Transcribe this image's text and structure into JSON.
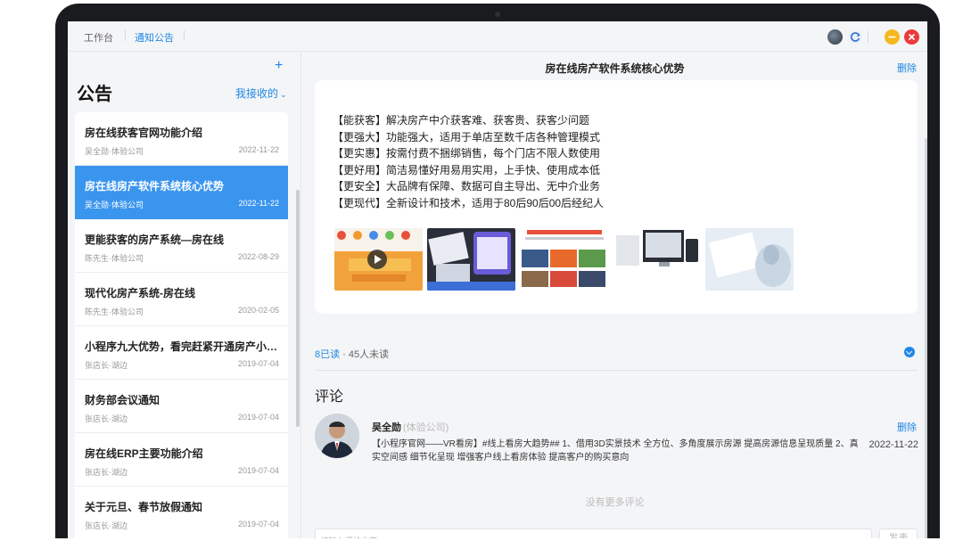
{
  "breadcrumbs": [
    "工作台",
    "通知公告"
  ],
  "colors": {
    "accent": "#1f87e5",
    "selected_row": "#3a95ee",
    "minimize": "#f6b820",
    "close": "#ec3a3a"
  },
  "toolbar_icons": [
    "avatar-icon",
    "refresh-icon",
    "minimize-icon",
    "close-icon"
  ],
  "left": {
    "title": "公告",
    "add_icon": "+",
    "filter_label": "我接收的",
    "filter_chevron": "⌄"
  },
  "announcements": [
    {
      "title": "房在线获客官网功能介绍",
      "author": "吴全勋·体验公司",
      "date": "2022-11-22",
      "selected": false
    },
    {
      "title": "房在线房产软件系统核心优势",
      "author": "吴全勋·体验公司",
      "date": "2022-11-22",
      "selected": true
    },
    {
      "title": "更能获客的房产系统—房在线",
      "author": "陈先生·体验公司",
      "date": "2022-08-29",
      "selected": false
    },
    {
      "title": "现代化房产系统-房在线",
      "author": "陈先生·体验公司",
      "date": "2020-02-05",
      "selected": false
    },
    {
      "title": "小程序九大优势，看完赶紧开通房产小程序",
      "author": "张店长·湖边",
      "date": "2019-07-04",
      "selected": false
    },
    {
      "title": "财务部会议通知",
      "author": "张店长·湖边",
      "date": "2019-07-04",
      "selected": false
    },
    {
      "title": "房在线ERP主要功能介绍",
      "author": "张店长·湖边",
      "date": "2019-07-04",
      "selected": false
    },
    {
      "title": "关于元旦、春节放假通知",
      "author": "张店长·湖边",
      "date": "2019-07-04",
      "selected": false
    }
  ],
  "detail": {
    "title": "房在线房产软件系统核心优势",
    "delete_label": "删除",
    "body": [
      "【能获客】解决房产中介获客难、获客贵、获客少问题",
      "【更强大】功能强大，适用于单店至数千店各种管理模式",
      "【更实惠】按需付费不捆绑销售，每个门店不限人数使用",
      "【更好用】简洁易懂好用易用实用，上手快、使用成本低",
      "【更安全】大品牌有保障、数据可自主导出、无中介业务",
      "【更现代】全新设计和技术，适用于80后90后00后经纪人"
    ],
    "thumbnails": [
      "video-thumbnail",
      "software-screens-thumbnail",
      "app-banner-thumbnail",
      "devices-thumbnail",
      "robot-thumbnail"
    ]
  },
  "read_status": {
    "read": "8已读",
    "separator": " · ",
    "unread": "45人未读"
  },
  "comments": {
    "heading": "评论",
    "items": [
      {
        "name": "吴全勋",
        "org": "(体验公司)",
        "text": "【小程序官网——VR看房】#线上看房大趋势## 1、借用3D实景技术 全方位、多角度展示房源 提高房源信息呈现质量 2、真实空间感 细节化呈现 增强客户线上看房体验 提高客户的购买意向",
        "date": "2022-11-22",
        "delete_label": "删除"
      }
    ],
    "no_more": "没有更多评论",
    "input_placeholder": "请输入评论内容",
    "send_label": "发表"
  }
}
